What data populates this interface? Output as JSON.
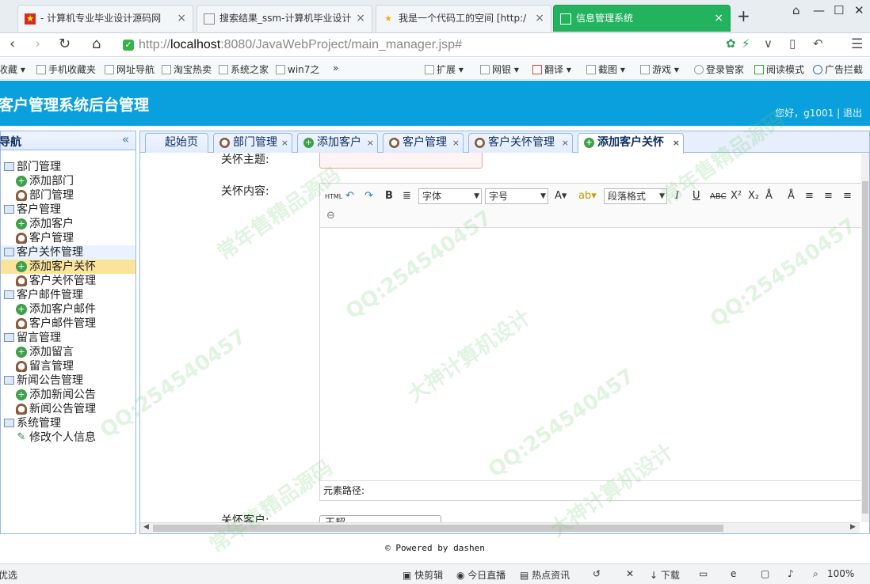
{
  "browser": {
    "tabs": [
      {
        "label": "- 计算机专业毕业设计源码网"
      },
      {
        "label": "搜索结果_ssm-计算机毕业设计"
      },
      {
        "label": "我是一个代码工的空间 [http:/"
      },
      {
        "label": "信息管理系统"
      }
    ],
    "url_scheme": "http://",
    "url_host": "localhost",
    "url_rest": ":8080/JavaWebProject/main_manager.jsp#",
    "bookmarks": [
      "收藏",
      "手机收藏夹",
      "网址导航",
      "淘宝热卖",
      "系统之家",
      "win7之"
    ],
    "bookmark_more": "»",
    "right_tools": [
      "扩展",
      "网银",
      "翻译",
      "截图",
      "游戏",
      "登录管家",
      "阅读模式",
      "广告拦截"
    ]
  },
  "app": {
    "title": "客户管理系统后台管理",
    "greeting": "您好，g1001 | 退出"
  },
  "nav": {
    "title": "导航",
    "collapse": "«",
    "groups": [
      {
        "label": "部门管理",
        "items": [
          {
            "label": "添加部门",
            "icon": "add"
          },
          {
            "label": "部门管理",
            "icon": "user"
          }
        ]
      },
      {
        "label": "客户管理",
        "items": [
          {
            "label": "添加客户",
            "icon": "add"
          },
          {
            "label": "客户管理",
            "icon": "user"
          }
        ]
      },
      {
        "label": "客户关怀管理",
        "items": [
          {
            "label": "添加客户关怀",
            "icon": "add"
          },
          {
            "label": "客户关怀管理",
            "icon": "user"
          }
        ]
      },
      {
        "label": "客户邮件管理",
        "items": [
          {
            "label": "添加客户邮件",
            "icon": "add"
          },
          {
            "label": "客户邮件管理",
            "icon": "user"
          }
        ]
      },
      {
        "label": "留言管理",
        "items": [
          {
            "label": "添加留言",
            "icon": "add"
          },
          {
            "label": "留言管理",
            "icon": "user"
          }
        ]
      },
      {
        "label": "新闻公告管理",
        "items": [
          {
            "label": "添加新闻公告",
            "icon": "add"
          },
          {
            "label": "新闻公告管理",
            "icon": "user"
          }
        ]
      },
      {
        "label": "系统管理",
        "items": [
          {
            "label": "修改个人信息",
            "icon": "edit"
          }
        ]
      }
    ]
  },
  "content_tabs": [
    {
      "label": "起始页"
    },
    {
      "label": "部门管理"
    },
    {
      "label": "添加客户"
    },
    {
      "label": "客户管理"
    },
    {
      "label": "客户关怀管理"
    },
    {
      "label": "添加客户关怀"
    }
  ],
  "form": {
    "title_label": "关怀主题:",
    "content_label": "关怀内容:",
    "customer_label": "关怀客户:",
    "customer_value": "王超",
    "editor": {
      "html_btn": "HTML",
      "font_select": "字体",
      "size_select": "字号",
      "para_select": "段落格式",
      "path_label": "元素路径:"
    }
  },
  "footer": "© Powered by dashen",
  "status": {
    "left": "优选",
    "items": [
      "快剪辑",
      "今日直播",
      "热点资讯",
      "下载"
    ],
    "zoom": "100%"
  },
  "watermarks": [
    "QQ:254540457",
    "常年售精品源码",
    "大神计算机设计"
  ]
}
